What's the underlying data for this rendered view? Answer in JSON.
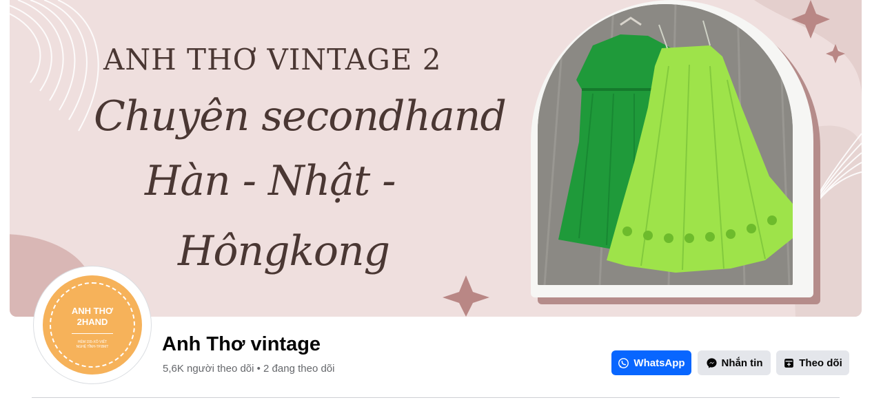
{
  "cover": {
    "line1": "ANH THƠ VINTAGE 2",
    "line2": "Chuyên secondhand",
    "line3": "Hàn - Nhật -",
    "line4": "Hôngkong"
  },
  "avatar": {
    "title_line1": "ANH THƠ",
    "title_line2": "2HAND",
    "sub_line1": "HẺM 155-XÔ VIẾT",
    "sub_line2": "NGHỆ TĨNH-TP.BMT"
  },
  "profile": {
    "name": "Anh Thơ vintage",
    "stats": "5,6K người theo dõi • 2 đang theo dõi"
  },
  "actions": {
    "whatsapp_label": "WhatsApp",
    "message_label": "Nhắn tin",
    "follow_label": "Theo dõi"
  },
  "icons": {
    "whatsapp": "whatsapp-icon",
    "messenger": "messenger-icon",
    "follow": "follow-icon"
  },
  "colors": {
    "primary": "#0866ff",
    "secondary_button": "#e4e6eb",
    "cover_background": "#efdfde",
    "avatar_orange": "#f6b25a",
    "dress_dark_green": "#1f9a3a",
    "dress_lime": "#9ee34a"
  }
}
